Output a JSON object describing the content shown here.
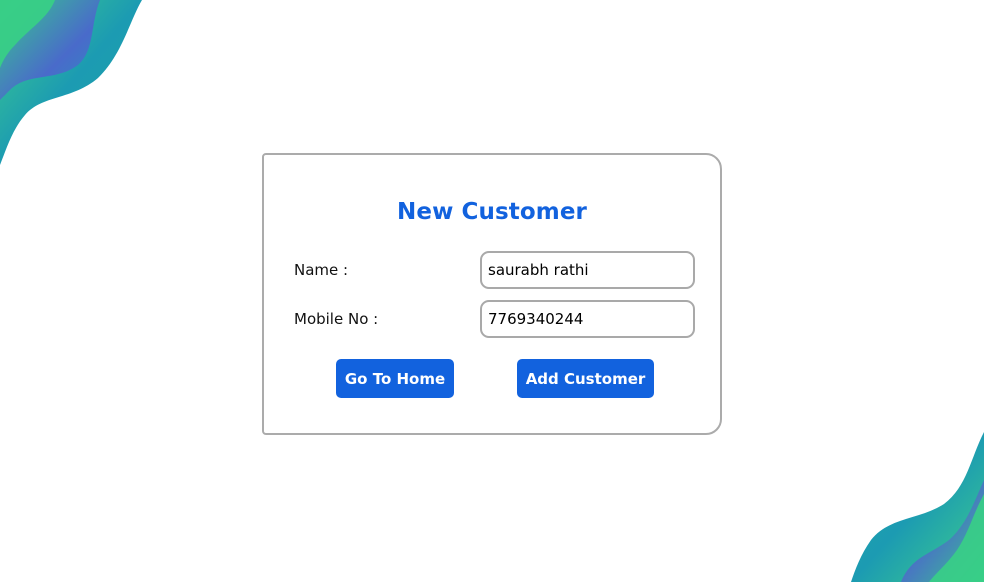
{
  "form": {
    "title": "New Customer",
    "name_label": "Name :",
    "name_value": "saurabh rathi",
    "mobile_label": "Mobile No :",
    "mobile_value": "7769340244"
  },
  "buttons": {
    "home_label": "Go To Home",
    "add_label": "Add Customer"
  },
  "colors": {
    "accent": "#1262de",
    "wave_green": "#2fc88a",
    "wave_teal": "#1a98b3",
    "wave_purple": "#4a67cf"
  }
}
